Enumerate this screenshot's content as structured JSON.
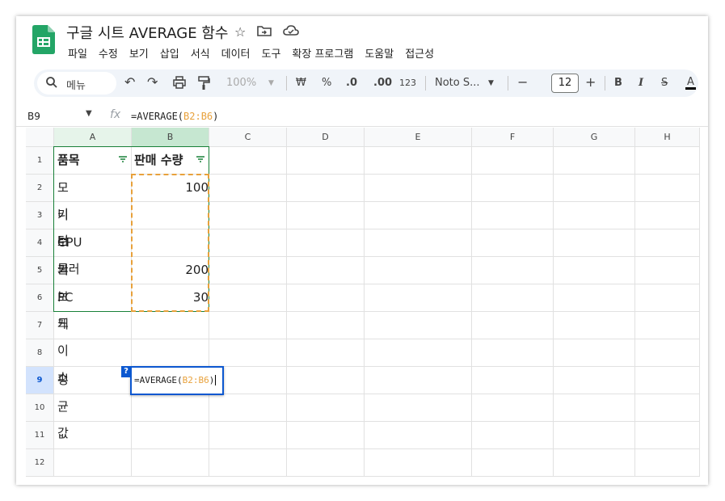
{
  "app": {
    "title": "구글 시트 AVERAGE 함수",
    "menu": [
      "파일",
      "수정",
      "보기",
      "삽입",
      "서식",
      "데이터",
      "도구",
      "확장 프로그램",
      "도움말",
      "접근성"
    ]
  },
  "toolbar": {
    "search_label": "메뉴",
    "zoom": "100%",
    "currency": "₩",
    "percent": "%",
    "dec_decrease": ".0",
    "dec_increase": ".00",
    "number_format": "123",
    "font": "Noto S...",
    "font_size": "12",
    "minus": "−",
    "plus": "+",
    "bold": "B",
    "italic": "I",
    "strike": "S",
    "text_color": "A"
  },
  "formula_bar": {
    "cell_ref": "B9",
    "fx": "fx",
    "formula_prefix": "=AVERAGE(",
    "formula_range": "B2:B6",
    "formula_suffix": ")"
  },
  "columns": [
    "A",
    "B",
    "C",
    "D",
    "E",
    "F",
    "G",
    "H"
  ],
  "rows": [
    "1",
    "2",
    "3",
    "4",
    "5",
    "6",
    "7",
    "8",
    "9",
    "10",
    "11",
    "12"
  ],
  "cells": {
    "a1": "품목",
    "b1": "판매 수량",
    "a2": "모니터",
    "b2": "100",
    "a3": "키보드",
    "a4": "CPU쿨러",
    "a5": "키보드",
    "b5": "200",
    "a6": "PC 케이스",
    "b6": "30",
    "a9": "평균 값"
  },
  "editor": {
    "prefix": "=AVERAGE(",
    "range": "B2:B6",
    "suffix": ")",
    "help": "?"
  },
  "colors": {
    "accent": "#0b57d0",
    "reference": "#e8a13b",
    "green": "#188038"
  }
}
